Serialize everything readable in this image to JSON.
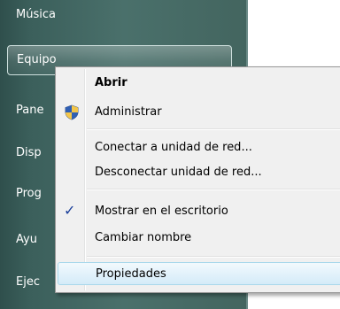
{
  "start_menu": {
    "items": [
      {
        "id": "musica",
        "label": "Música"
      },
      {
        "id": "equipo",
        "label": "Equipo"
      },
      {
        "id": "panel",
        "label": "Pane"
      },
      {
        "id": "dispositivos",
        "label": "Disp"
      },
      {
        "id": "programas",
        "label": "Prog"
      },
      {
        "id": "ayuda",
        "label": "Ayu"
      },
      {
        "id": "ejecutar",
        "label": "Ejec"
      }
    ]
  },
  "context_menu": {
    "items": [
      {
        "label": "Abrir",
        "bold": true
      },
      {
        "label": "Administrar",
        "icon": "uac-shield-icon"
      },
      {
        "label": "Conectar a unidad de red..."
      },
      {
        "label": "Desconectar unidad de red..."
      },
      {
        "label": "Mostrar en el escritorio",
        "checked": true,
        "icon": "checkmark-icon"
      },
      {
        "label": "Cambiar nombre"
      },
      {
        "label": "Propiedades",
        "highlighted": true
      }
    ]
  },
  "colors": {
    "start_pane": "#4a706b",
    "menu_bg": "#f0f0f0",
    "hover_border": "#a8d8eb",
    "check": "#1a3e9a"
  }
}
